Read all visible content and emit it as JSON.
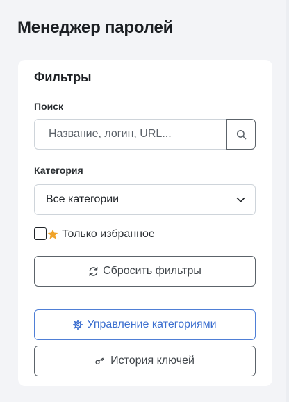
{
  "page": {
    "title": "Менеджер паролей"
  },
  "filters": {
    "title": "Фильтры",
    "search": {
      "label": "Поиск",
      "placeholder": "Название, логин, URL...",
      "value": ""
    },
    "category": {
      "label": "Категория",
      "selected": "Все категории"
    },
    "favorites": {
      "label": "Только избранное",
      "checked": false,
      "star_color": "#f0a32a"
    },
    "reset_label": "Сбросить фильтры",
    "manage_categories_label": "Управление категориями",
    "key_history_label": "История ключей"
  },
  "colors": {
    "accent": "#3c6fcf",
    "secondary": "#5c636a",
    "background": "#f3f4f7"
  },
  "icons": {
    "search": "search-icon",
    "chevron": "chevron-down-icon",
    "star": "star-icon",
    "reset": "refresh-icon",
    "manage": "gear-icon",
    "history": "key-icon"
  }
}
